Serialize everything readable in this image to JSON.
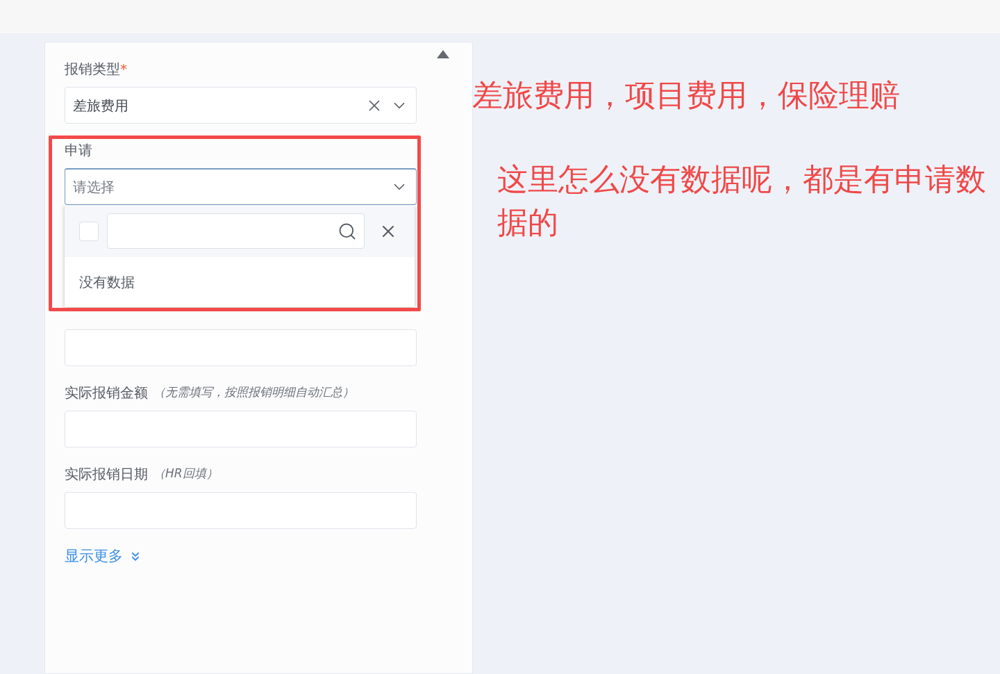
{
  "form": {
    "fields": [
      {
        "kind": "select",
        "label": "报销类型",
        "required_mark": "*",
        "value": "差旅费用",
        "clearable": true,
        "open": false
      },
      {
        "kind": "select",
        "label": "申请",
        "placeholder": "请选择",
        "clearable": false,
        "open": true,
        "dropdown": {
          "checked": false,
          "empty_text": "没有数据"
        }
      },
      {
        "kind": "text"
      },
      {
        "kind": "text",
        "label": "实际报销金额",
        "hint": "（无需填写，按照报销明细自动汇总）"
      },
      {
        "kind": "text",
        "label": "实际报销日期",
        "hint": "（HR回填）"
      }
    ],
    "show_more": "显示更多"
  },
  "annotations": [
    "差旅费用，项目费用，保险理赔",
    "这里怎么没有数据呢，都是有申请数据的"
  ]
}
